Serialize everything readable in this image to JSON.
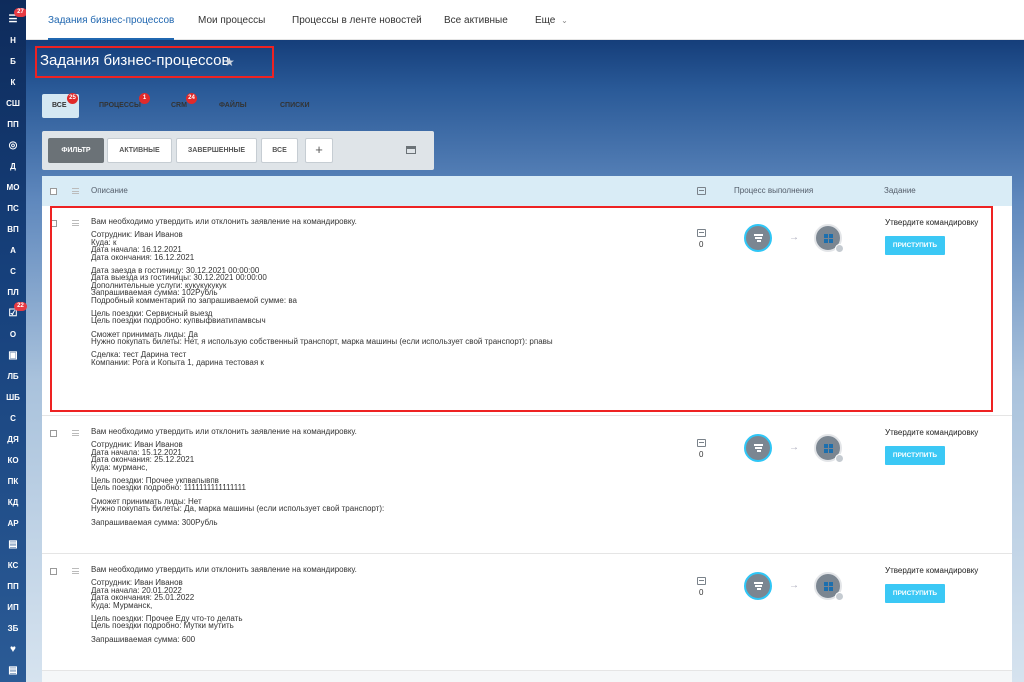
{
  "sidebar": {
    "items": [
      {
        "label": "",
        "icon": "filter-icon",
        "badge": "27"
      },
      {
        "label": "Н"
      },
      {
        "label": "Б"
      },
      {
        "label": "К"
      },
      {
        "label": "СШ"
      },
      {
        "label": "ПП"
      },
      {
        "label": "",
        "icon": "target-icon"
      },
      {
        "label": "Д"
      },
      {
        "label": "МО"
      },
      {
        "label": "ПС"
      },
      {
        "label": "ВП"
      },
      {
        "label": "А"
      },
      {
        "label": "С"
      },
      {
        "label": "ПЛ"
      },
      {
        "label": "",
        "icon": "tasks-icon",
        "badge": "22"
      },
      {
        "label": "О"
      },
      {
        "label": "",
        "icon": "id-card-icon"
      },
      {
        "label": "ЛБ"
      },
      {
        "label": "ШБ"
      },
      {
        "label": "С"
      },
      {
        "label": "ДЯ"
      },
      {
        "label": "КО"
      },
      {
        "label": "ПК"
      },
      {
        "label": "КД"
      },
      {
        "label": "АР"
      },
      {
        "label": "",
        "icon": "document-icon"
      },
      {
        "label": "КС"
      },
      {
        "label": "ПП"
      },
      {
        "label": "ИП"
      },
      {
        "label": "ЗБ"
      },
      {
        "label": "",
        "icon": "heart-icon"
      },
      {
        "label": "",
        "icon": "list-icon"
      }
    ]
  },
  "topnav": {
    "tabs": [
      "Задания бизнес-процессов",
      "Мои процессы",
      "Процессы в ленте новостей",
      "Все активные",
      "Еще"
    ],
    "more_chevron": "⌄"
  },
  "page": {
    "title": "Задания бизнес-процессов",
    "star": "★"
  },
  "subtabs": [
    {
      "label": "ВСЕ",
      "count": "25"
    },
    {
      "label": "ПРОЦЕССЫ",
      "count": "1"
    },
    {
      "label": "CRM",
      "count": "24"
    },
    {
      "label": "ФАЙЛЫ"
    },
    {
      "label": "СПИСКИ"
    }
  ],
  "filters": {
    "filter": "ФИЛЬТР",
    "active": "АКТИВНЫЕ",
    "completed": "ЗАВЕРШЕННЫЕ",
    "all": "ВСЕ",
    "add": "+"
  },
  "grid": {
    "headers": {
      "description": "Описание",
      "progress": "Процесс выполнения",
      "task": "Задание"
    },
    "rows": [
      {
        "lines": [
          "Вам необходимо утвердить или отклонить заявление на командировку.",
          "",
          "Сотрудник: Иван Иванов",
          "Куда: к",
          "Дата начала: 16.12.2021",
          "Дата окончания: 16.12.2021",
          "",
          "Дата заезда в гостиницу: 30.12.2021 00:00:00",
          "Дата выезда из гостиницы: 30.12.2021 00:00:00",
          "Дополнительные услуги: кукукукукук",
          "Запрашиваемая сумма: 102Рубль",
          "Подробный комментарий по запрашиваемой сумме: ва",
          "",
          "Цель поездки: Сервисный выезд",
          "Цель поездки подробно: купвыфвиатипамвсыч",
          "",
          "Сможет принимать лиды: Да",
          "Нужно покупать билеты: Нет, я использую собственный транспорт, марка машины (если использует свой транспорт): рпавы",
          "",
          "Сделка: тест Дарина тест",
          "Компании: Рога и Копыта 1, дарина тестовая к"
        ],
        "comments": "0",
        "task": "Утвердите командировку",
        "button": "ПРИСТУПИТЬ"
      },
      {
        "lines": [
          "Вам необходимо утвердить или отклонить заявление на командировку.",
          "",
          "Сотрудник: Иван Иванов",
          "Дата начала: 15.12.2021",
          "Дата окончания: 25.12.2021",
          "Куда: мурманс,",
          "",
          "Цель поездки: Прочее укпвапывпв",
          "Цель поездки подробно: 1111111111111111",
          "",
          "Сможет принимать лиды: Нет",
          "Нужно покупать билеты: Да, марка машины (если использует свой транспорт):",
          "",
          "Запрашиваемая сумма: 300Рубль"
        ],
        "comments": "0",
        "task": "Утвердите командировку",
        "button": "ПРИСТУПИТЬ"
      },
      {
        "lines": [
          "Вам необходимо утвердить или отклонить заявление на командировку.",
          "",
          "Сотрудник: Иван Иванов",
          "Дата начала: 20.01.2022",
          "Дата окончания: 25.01.2022",
          "Куда: Мурманск,",
          "",
          "Цель поездки: Прочее Еду что-то делать",
          "Цель поездки подробно: Мутки мутить",
          "",
          "Запрашиваемая сумма: 600"
        ],
        "comments": "0",
        "task": "Утвердите командировку",
        "button": "ПРИСТУПИТЬ"
      }
    ]
  },
  "colors": {
    "accent": "#2067b0",
    "button": "#3bc8f5",
    "badge": "#e02a2a",
    "highlight": "#ee2222"
  }
}
